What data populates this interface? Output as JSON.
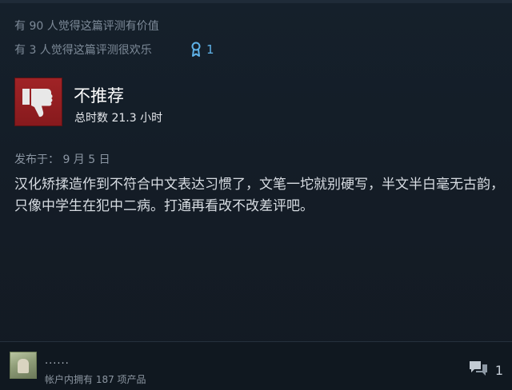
{
  "helpful": {
    "helpful_line": "有 90 人觉得这篇评测有价值",
    "funny_line": "有 3 人觉得这篇评测很欢乐",
    "award_count": "1"
  },
  "review": {
    "verdict": "不推荐",
    "hours": "总时数 21.3 小时",
    "posted": "发布于： 9 月 5 日",
    "text": "汉化矫揉造作到不符合中文表达习惯了，文笔一坨就别硬写，半文半白毫无古韵，只像中学生在犯中二病。打通再看改不改差评吧。"
  },
  "author": {
    "name": "......",
    "owned": "帐户内拥有 187 项产品"
  },
  "footer": {
    "comment_count": "1"
  },
  "colors": {
    "thumb_red": "#a02326",
    "award_blue": "#5fb2e8",
    "background": "#131b24"
  },
  "icons": {
    "thumb": "thumbs-down-icon",
    "award": "award-ribbon-icon",
    "comment": "comment-bubbles-icon"
  }
}
